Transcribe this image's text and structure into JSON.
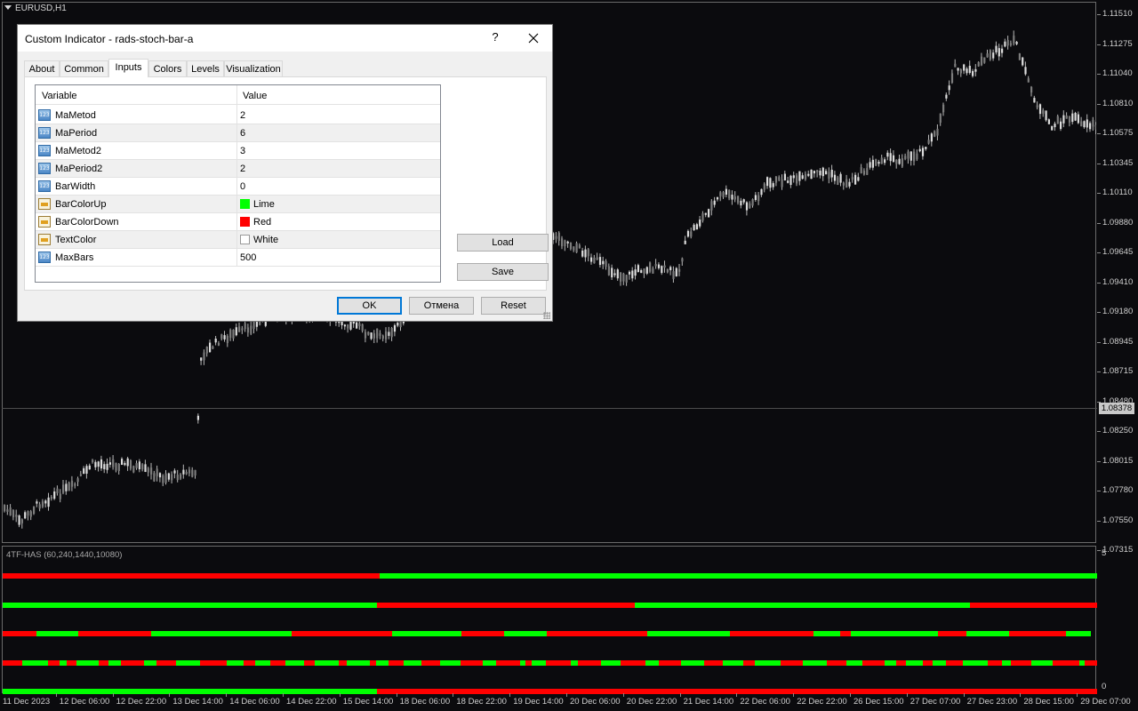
{
  "chart": {
    "symbol_label": "EURUSD,H1",
    "price_ticks": [
      "1.11510",
      "1.11275",
      "1.11040",
      "1.10810",
      "1.10575",
      "1.10345",
      "1.10110",
      "1.09880",
      "1.09645",
      "1.09410",
      "1.09180",
      "1.08945",
      "1.08715",
      "1.08480",
      "1.08250",
      "1.08015",
      "1.07780",
      "1.07550",
      "1.07315"
    ],
    "current_price": "1.08378",
    "time_labels": [
      "11 Dec 2023",
      "12 Dec 06:00",
      "12 Dec 22:00",
      "13 Dec 14:00",
      "14 Dec 06:00",
      "14 Dec 22:00",
      "15 Dec 14:00",
      "18 Dec 06:00",
      "18 Dec 22:00",
      "19 Dec 14:00",
      "20 Dec 06:00",
      "20 Dec 22:00",
      "21 Dec 14:00",
      "22 Dec 06:00",
      "22 Dec 22:00",
      "26 Dec 15:00",
      "27 Dec 07:00",
      "27 Dec 23:00",
      "28 Dec 15:00",
      "29 Dec 07:00"
    ]
  },
  "indicator": {
    "label": "4TF-HAS (60,240,1440,10080)",
    "scale_top": "5",
    "scale_bottom": "0",
    "colors": {
      "up": "#00ff00",
      "down": "#ff0000"
    }
  },
  "dialog": {
    "title": "Custom Indicator - rads-stoch-bar-a",
    "help": "?",
    "tabs": [
      "About",
      "Common",
      "Inputs",
      "Colors",
      "Levels",
      "Visualization"
    ],
    "active_tab": "Inputs",
    "grid_headers": {
      "variable": "Variable",
      "value": "Value"
    },
    "rows": [
      {
        "name": "MaMetod",
        "value": "2",
        "icon": "number-icon"
      },
      {
        "name": "MaPeriod",
        "value": "6",
        "icon": "number-icon"
      },
      {
        "name": "MaMetod2",
        "value": "3",
        "icon": "number-icon"
      },
      {
        "name": "MaPeriod2",
        "value": "2",
        "icon": "number-icon"
      },
      {
        "name": "BarWidth",
        "value": "0",
        "icon": "number-icon"
      },
      {
        "name": "BarColorUp",
        "value": "Lime",
        "icon": "color-icon",
        "swatch": "#00ff00"
      },
      {
        "name": "BarColorDown",
        "value": "Red",
        "icon": "color-icon",
        "swatch": "#ff0000"
      },
      {
        "name": "TextColor",
        "value": "White",
        "icon": "color-icon",
        "swatch": "#ffffff"
      },
      {
        "name": "MaxBars",
        "value": "500",
        "icon": "number-icon"
      }
    ],
    "buttons": {
      "load": "Load",
      "save": "Save",
      "ok": "OK",
      "cancel": "Отмена",
      "reset": "Reset"
    }
  }
}
